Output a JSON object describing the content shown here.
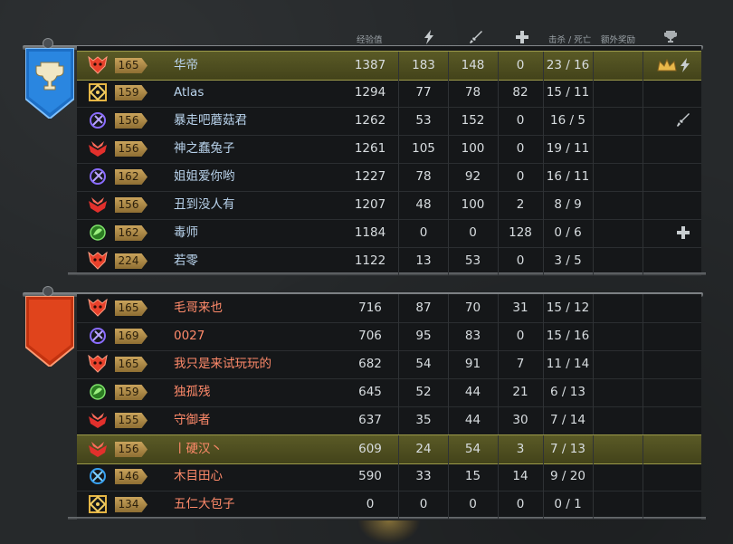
{
  "header": {
    "xp": "经验值",
    "kill_da": "击杀 / 死亡",
    "bonus": "额外奖励"
  },
  "blue_team": [
    {
      "hero": "red-demon",
      "level": "165",
      "name": "华帝",
      "xp": "1387",
      "kills": "183",
      "pushes": "148",
      "heals": "0",
      "kd": "23 / 16",
      "award": "crown-lightning"
    },
    {
      "hero": "gold-knot",
      "level": "159",
      "name": "Atlas",
      "xp": "1294",
      "kills": "77",
      "pushes": "78",
      "heals": "82",
      "kd": "15 / 11",
      "award": ""
    },
    {
      "hero": "purple-rune",
      "level": "156",
      "name": "暴走吧蘑菇君",
      "xp": "1262",
      "kills": "53",
      "pushes": "152",
      "heals": "0",
      "kd": "16 / 5",
      "award": "sword"
    },
    {
      "hero": "red-wing",
      "level": "156",
      "name": "神之蠢兔子",
      "xp": "1261",
      "kills": "105",
      "pushes": "100",
      "heals": "0",
      "kd": "19 / 11",
      "award": ""
    },
    {
      "hero": "purple-rune",
      "level": "162",
      "name": "姐姐爱你哟",
      "xp": "1227",
      "kills": "78",
      "pushes": "92",
      "heals": "0",
      "kd": "16 / 11",
      "award": ""
    },
    {
      "hero": "red-wing",
      "level": "156",
      "name": "丑到没人有",
      "xp": "1207",
      "kills": "48",
      "pushes": "100",
      "heals": "2",
      "kd": "8 / 9",
      "award": ""
    },
    {
      "hero": "green-leaf",
      "level": "162",
      "name": "毒师",
      "xp": "1184",
      "kills": "0",
      "pushes": "0",
      "heals": "128",
      "kd": "0 / 6",
      "award": "cross"
    },
    {
      "hero": "red-demon",
      "level": "224",
      "name": "若零",
      "xp": "1122",
      "kills": "13",
      "pushes": "53",
      "heals": "0",
      "kd": "3 / 5",
      "award": ""
    }
  ],
  "red_team": [
    {
      "hero": "red-demon",
      "level": "165",
      "name": "毛哥来也",
      "xp": "716",
      "kills": "87",
      "pushes": "70",
      "heals": "31",
      "kd": "15 / 12"
    },
    {
      "hero": "purple-rune",
      "level": "169",
      "name": "0027",
      "xp": "706",
      "kills": "95",
      "pushes": "83",
      "heals": "0",
      "kd": "15 / 16"
    },
    {
      "hero": "red-demon",
      "level": "165",
      "name": "我只是来试玩玩的",
      "xp": "682",
      "kills": "54",
      "pushes": "91",
      "heals": "7",
      "kd": "11 / 14"
    },
    {
      "hero": "green-leaf",
      "level": "159",
      "name": "独孤残",
      "xp": "645",
      "kills": "52",
      "pushes": "44",
      "heals": "21",
      "kd": "6 / 13"
    },
    {
      "hero": "red-wing",
      "level": "155",
      "name": "守御者",
      "xp": "637",
      "kills": "35",
      "pushes": "44",
      "heals": "30",
      "kd": "7 / 14"
    },
    {
      "hero": "red-wing",
      "level": "156",
      "name": "丨硬汉丶",
      "xp": "609",
      "kills": "24",
      "pushes": "54",
      "heals": "3",
      "kd": "7 / 13"
    },
    {
      "hero": "blue-rune",
      "level": "146",
      "name": "木目田心",
      "xp": "590",
      "kills": "33",
      "pushes": "15",
      "heals": "14",
      "kd": "9 / 20"
    },
    {
      "hero": "gold-knot",
      "level": "134",
      "name": "五仁大包子",
      "xp": "0",
      "kills": "0",
      "pushes": "0",
      "heals": "0",
      "kd": "0 / 1"
    }
  ],
  "colors": {
    "blue_name": "#b9d3ec",
    "red_name": "#ff8a6a",
    "highlight": "#5a5a26",
    "level_badge": "#c9a35b",
    "blue_banner": "#1d6fc6",
    "red_banner": "#e0441c"
  },
  "icons": {
    "kills": "lightning-icon",
    "pushes": "sword-icon",
    "heals": "cross-icon",
    "bonus": "trophy-icon"
  }
}
